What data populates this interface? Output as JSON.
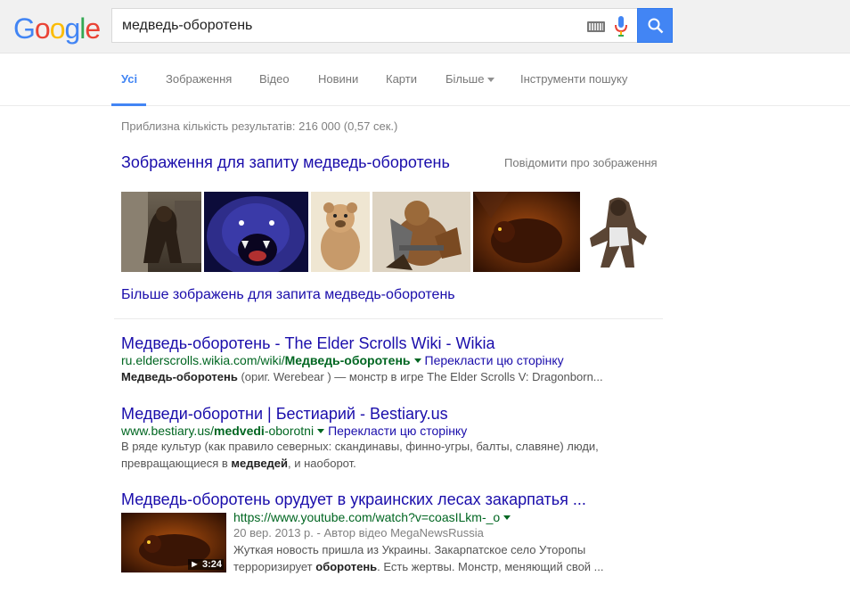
{
  "header": {
    "logo_letters": [
      {
        "ch": "G",
        "color": "#4285f4"
      },
      {
        "ch": "o",
        "color": "#ea4335"
      },
      {
        "ch": "o",
        "color": "#fbbc05"
      },
      {
        "ch": "g",
        "color": "#4285f4"
      },
      {
        "ch": "l",
        "color": "#34a853"
      },
      {
        "ch": "e",
        "color": "#ea4335"
      }
    ],
    "search_value": "медведь-оборотень"
  },
  "tabs": {
    "all": "Усі",
    "images": "Зображення",
    "video": "Відео",
    "news": "Новини",
    "maps": "Карти",
    "more": "Більше",
    "tools": "Інструменти пошуку"
  },
  "stats": "Приблизна кількість результатів: 216 000 (0,57 сек.)",
  "images_block": {
    "title": "Зображення для запиту медведь-оборотень",
    "report": "Повідомити про зображення",
    "more": "Більше зображень для запита медведь-оборотень"
  },
  "results": [
    {
      "title": "Медведь-оборотень - The Elder Scrolls Wiki - Wikia",
      "url_prefix": "ru.elderscrolls.wikia.com/wiki/",
      "url_bold": "Медведь-оборотень",
      "translate": "Перекласти цю сторінку",
      "snippet_bold": "Медведь-оборотень",
      "snippet_rest": " (ориг. Werebear ) — монстр в игре The Elder Scrolls V: Dragonborn..."
    },
    {
      "title": "Медведи-оборотни | Бестиарий - Bestiary.us",
      "url_prefix": "www.bestiary.us/",
      "url_bold": "medvedi",
      "url_suffix": "-oborotni",
      "translate": "Перекласти цю сторінку",
      "snippet_line1": "В ряде культур (как правило северных: скандинавы, финно-угры, балты, славяне) люди,",
      "snippet_line2_pre": "превращающиеся в ",
      "snippet_line2_bold": "медведей",
      "snippet_line2_post": ", и наоборот."
    },
    {
      "title": "Медведь-оборотень орудует в украинских лесах закарпатья ...",
      "url": "https://www.youtube.com/watch?v=coasILkm-_o",
      "date": "20 вер. 2013 р. - Автор відео MegaNewsRussia",
      "snippet_line1": "Жуткая новость пришла из Украины. Закарпатское село Уторопы",
      "snippet_line2_pre": "терроризирует ",
      "snippet_line2_bold": "оборотень",
      "snippet_line2_post": ". Есть жертвы. Монстр, меняющий свой ...",
      "duration": "► 3:24"
    }
  ]
}
